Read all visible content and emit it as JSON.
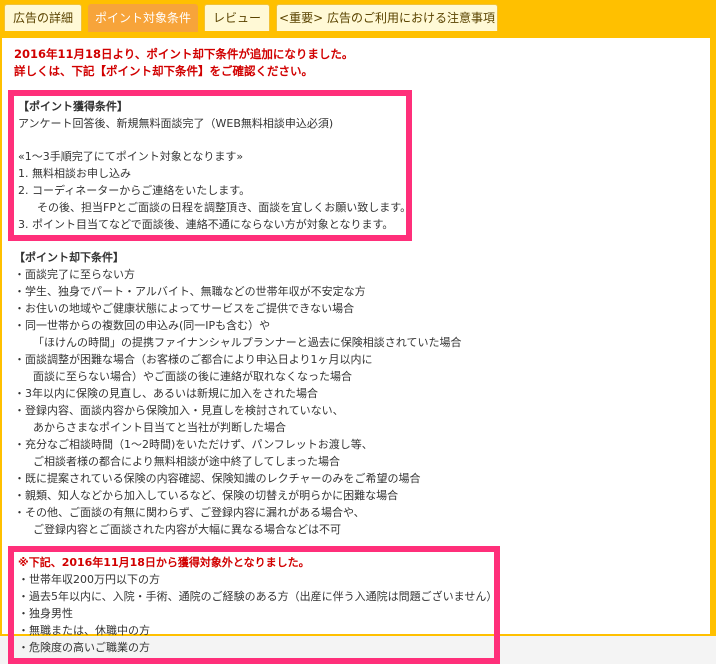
{
  "tabs": [
    {
      "label": "広告の詳細"
    },
    {
      "label": "ポイント対象条件"
    },
    {
      "label": "レビュー"
    },
    {
      "label": "<重要> 広告のご利用における注意事項"
    }
  ],
  "notice": {
    "line1": "2016年11月18日より、ポイント却下条件が追加になりました。",
    "line2": "詳しくは、下記【ポイント却下条件】をご確認ください。"
  },
  "earn": {
    "title": "【ポイント獲得条件】",
    "line1": "アンケート回答後、新規無料面談完了（WEB無料相談申込必須)",
    "line2": "«1～3手順完了にてポイント対象となります»",
    "steps": [
      "1.  無料相談お申し込み",
      "2.  コーディネーターからご連絡をいたします。",
      "その後、担当FPとご面談の日程を調整頂き、面談を宜しくお願い致します。",
      "3.  ポイント目当てなどで面談後、連絡不通にならない方が対象となります。"
    ]
  },
  "reject": {
    "title": "【ポイント却下条件】",
    "items": [
      "・面談完了に至らない方",
      "・学生、独身でパート・アルバイト、無職などの世帯年収が不安定な方",
      "・お住いの地域やご健康状態によってサービスをご提供できない場合",
      "・同一世帯からの複数回の申込み(同一IPも含む）や",
      "「ほけんの時間」の提携ファイナンシャルプランナーと過去に保険相談されていた場合",
      "・面談調整が困難な場合（お客様のご都合により申込日より1ヶ月以内に",
      "面談に至らない場合）やご面談の後に連絡が取れなくなった場合",
      "・3年以内に保険の見直し、あるいは新規に加入をされた場合",
      "・登録内容、面談内容から保険加入・見直しを検討されていない、",
      "あからさまなポイント目当てと当社が判断した場合",
      "・充分なご相談時間（1～2時間)をいただけず、パンフレットお渡し等、",
      "ご相談者様の都合により無料相談が途中終了してしまった場合",
      "・既に提案されている保険の内容確認、保険知識のレクチャーのみをご希望の場合",
      "・親類、知人などから加入しているなど、保険の切替えが明らかに困難な場合",
      "・その他、ご面談の有無に関わらず、ご登録内容に漏れがある場合や、",
      "ご登録内容とご面談された内容が大幅に異なる場合などは不可"
    ],
    "indented": [
      4,
      6,
      9,
      11,
      15
    ]
  },
  "excluded": {
    "title": "※下記、2016年11月18日から獲得対象外となりました。",
    "items": [
      "・世帯年収200万円以下の方",
      "・過去5年以内に、入院・手術、通院のご経験のある方（出産に伴う入通院は問題ございません）",
      "・独身男性",
      "・無職または、休職中の方",
      "・危険度の高いご職業の方"
    ]
  },
  "colors": {
    "tabbar": "#ffc000",
    "highlight": "#ff2f7a",
    "notice": "#d10000",
    "active_tab": "#f7a43a"
  }
}
